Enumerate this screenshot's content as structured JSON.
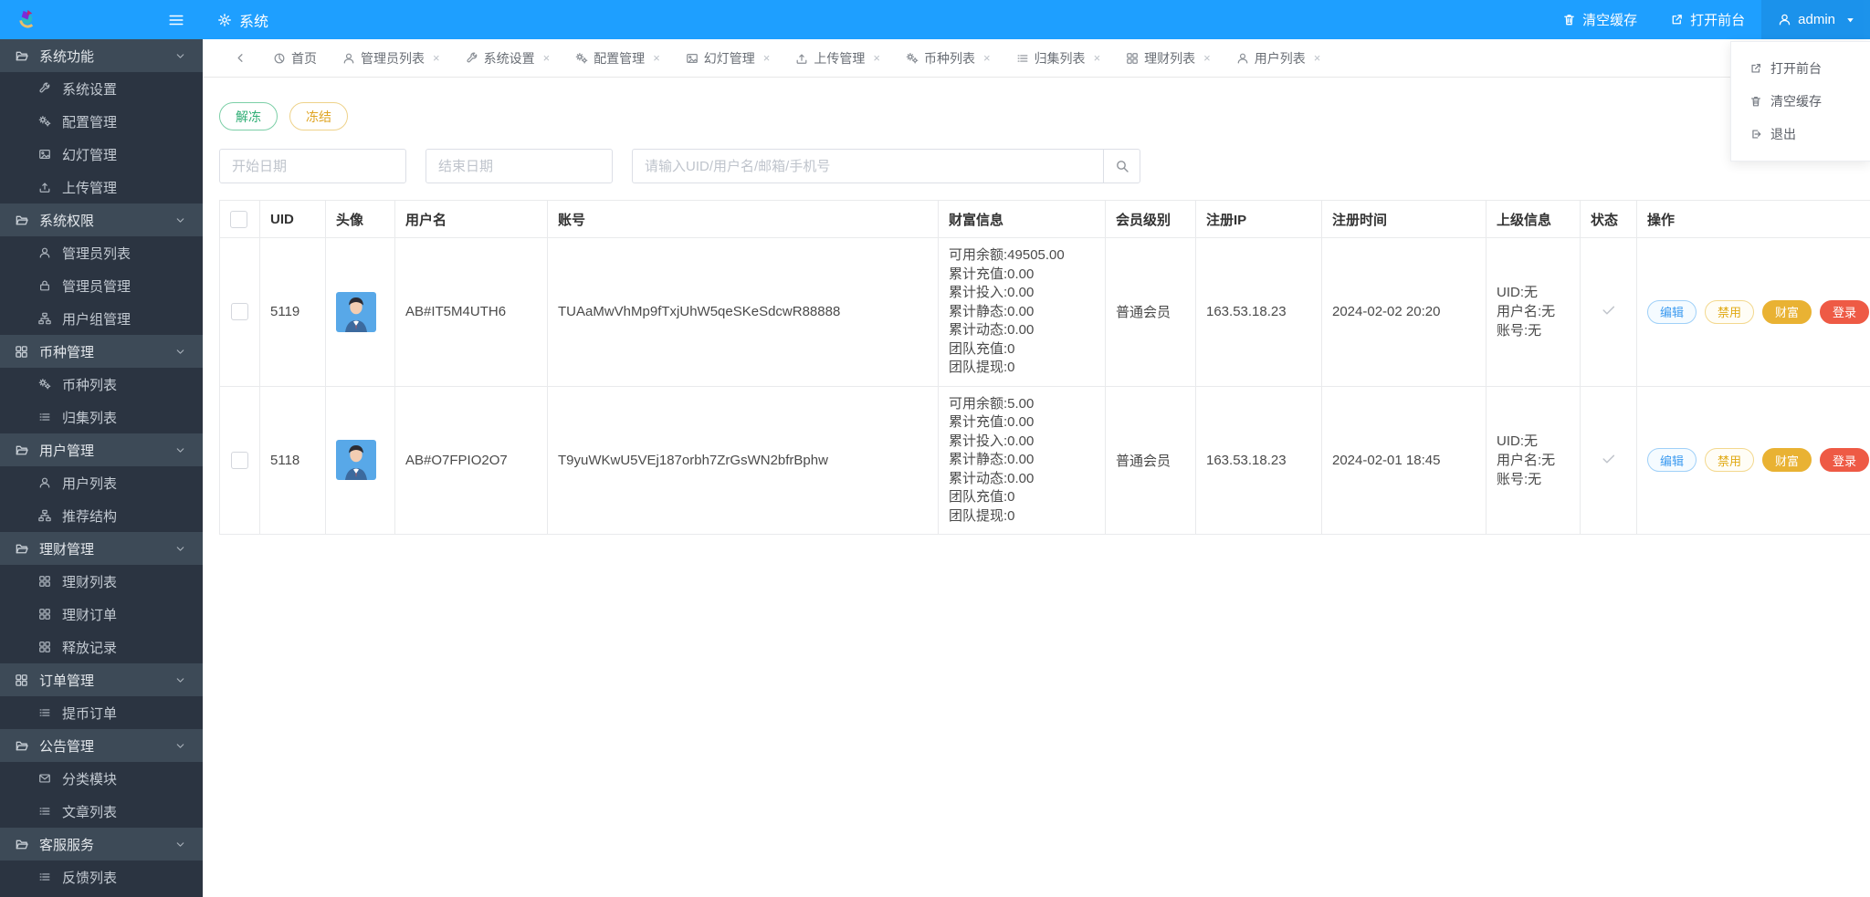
{
  "header": {
    "app_title": "系统",
    "clear_cache": "清空缓存",
    "open_front": "打开前台",
    "username": "admin",
    "dropdown": [
      {
        "icon": "external-link-icon",
        "label": "打开前台"
      },
      {
        "icon": "trash-icon",
        "label": "清空缓存"
      },
      {
        "icon": "logout-icon",
        "label": "退出"
      }
    ]
  },
  "sidebar": {
    "groups": [
      {
        "icon": "folder-icon",
        "label": "系统功能",
        "children": [
          {
            "icon": "wrench-icon",
            "label": "系统设置"
          },
          {
            "icon": "gears-icon",
            "label": "配置管理"
          },
          {
            "icon": "image-icon",
            "label": "幻灯管理"
          },
          {
            "icon": "upload-icon",
            "label": "上传管理"
          }
        ]
      },
      {
        "icon": "folder-icon",
        "label": "系统权限",
        "children": [
          {
            "icon": "user-icon",
            "label": "管理员列表"
          },
          {
            "icon": "lock-icon",
            "label": "管理员管理"
          },
          {
            "icon": "sitemap-icon",
            "label": "用户组管理"
          }
        ]
      },
      {
        "icon": "grid-icon",
        "label": "币种管理",
        "children": [
          {
            "icon": "gears-icon",
            "label": "币种列表"
          },
          {
            "icon": "list-icon",
            "label": "归集列表"
          }
        ]
      },
      {
        "icon": "folder-icon",
        "label": "用户管理",
        "children": [
          {
            "icon": "user-icon",
            "label": "用户列表"
          },
          {
            "icon": "sitemap-icon",
            "label": "推荐结构"
          }
        ]
      },
      {
        "icon": "folder-icon",
        "label": "理财管理",
        "children": [
          {
            "icon": "grid-icon",
            "label": "理财列表"
          },
          {
            "icon": "grid-icon",
            "label": "理财订单"
          },
          {
            "icon": "grid-icon",
            "label": "释放记录"
          }
        ]
      },
      {
        "icon": "grid-icon",
        "label": "订单管理",
        "children": [
          {
            "icon": "list-icon",
            "label": "提币订单"
          }
        ]
      },
      {
        "icon": "folder-icon",
        "label": "公告管理",
        "children": [
          {
            "icon": "envelope-icon",
            "label": "分类模块"
          },
          {
            "icon": "list-icon",
            "label": "文章列表"
          }
        ]
      },
      {
        "icon": "folder-icon",
        "label": "客服服务",
        "children": [
          {
            "icon": "list-icon",
            "label": "反馈列表"
          }
        ]
      }
    ]
  },
  "tabs": [
    {
      "icon": "home-icon",
      "label": "首页",
      "closable": false
    },
    {
      "icon": "user-icon",
      "label": "管理员列表",
      "closable": true
    },
    {
      "icon": "wrench-icon",
      "label": "系统设置",
      "closable": true
    },
    {
      "icon": "gears-icon",
      "label": "配置管理",
      "closable": true
    },
    {
      "icon": "image-icon",
      "label": "幻灯管理",
      "closable": true
    },
    {
      "icon": "upload-icon",
      "label": "上传管理",
      "closable": true
    },
    {
      "icon": "gears-icon",
      "label": "币种列表",
      "closable": true
    },
    {
      "icon": "list-icon",
      "label": "归集列表",
      "closable": true
    },
    {
      "icon": "grid-icon",
      "label": "理财列表",
      "closable": true
    },
    {
      "icon": "user-icon",
      "label": "用户列表",
      "closable": true
    }
  ],
  "toolbar": {
    "unfreeze_label": "解冻",
    "freeze_label": "冻结"
  },
  "filters": {
    "start_date_placeholder": "开始日期",
    "end_date_placeholder": "结束日期",
    "search_placeholder": "请输入UID/用户名/邮箱/手机号",
    "search_icon": "search-icon"
  },
  "table": {
    "columns": {
      "uid": "UID",
      "avatar": "头像",
      "username": "用户名",
      "account": "账号",
      "wealth": "财富信息",
      "level": "会员级别",
      "reg_ip": "注册IP",
      "reg_time": "注册时间",
      "parent": "上级信息",
      "status": "状态",
      "actions": "操作"
    },
    "action_labels": {
      "edit": "编辑",
      "disable": "禁用",
      "wealth": "财富",
      "login": "登录"
    },
    "rows": [
      {
        "uid": "5119",
        "username": "AB#IT5M4UTH6",
        "account": "TUAaMwVhMp9fTxjUhW5qeSKeSdcwR88888",
        "wealth": [
          "可用余额:49505.00",
          "累计充值:0.00",
          "累计投入:0.00",
          "累计静态:0.00",
          "累计动态:0.00",
          "团队充值:0",
          "团队提现:0"
        ],
        "level": "普通会员",
        "reg_ip": "163.53.18.23",
        "reg_time": "2024-02-02 20:20",
        "parent": [
          "UID:无",
          "用户名:无",
          "账号:无"
        ],
        "status": "check-icon"
      },
      {
        "uid": "5118",
        "username": "AB#O7FPIO2O7",
        "account": "T9yuWKwU5VEj187orbh7ZrGsWN2bfrBphw",
        "wealth": [
          "可用余额:5.00",
          "累计充值:0.00",
          "累计投入:0.00",
          "累计静态:0.00",
          "累计动态:0.00",
          "团队充值:0",
          "团队提现:0"
        ],
        "level": "普通会员",
        "reg_ip": "163.53.18.23",
        "reg_time": "2024-02-01 18:45",
        "parent": [
          "UID:无",
          "用户名:无",
          "账号:无"
        ],
        "status": "check-icon"
      }
    ]
  },
  "colors": {
    "header_blue": "#1e9fff",
    "sidebar_dark": "#2b3441",
    "sidebar_parent": "#3d4a57",
    "green": "#2fae75",
    "amber": "#dfa423",
    "gold": "#e9b233",
    "red": "#ee5a45"
  }
}
